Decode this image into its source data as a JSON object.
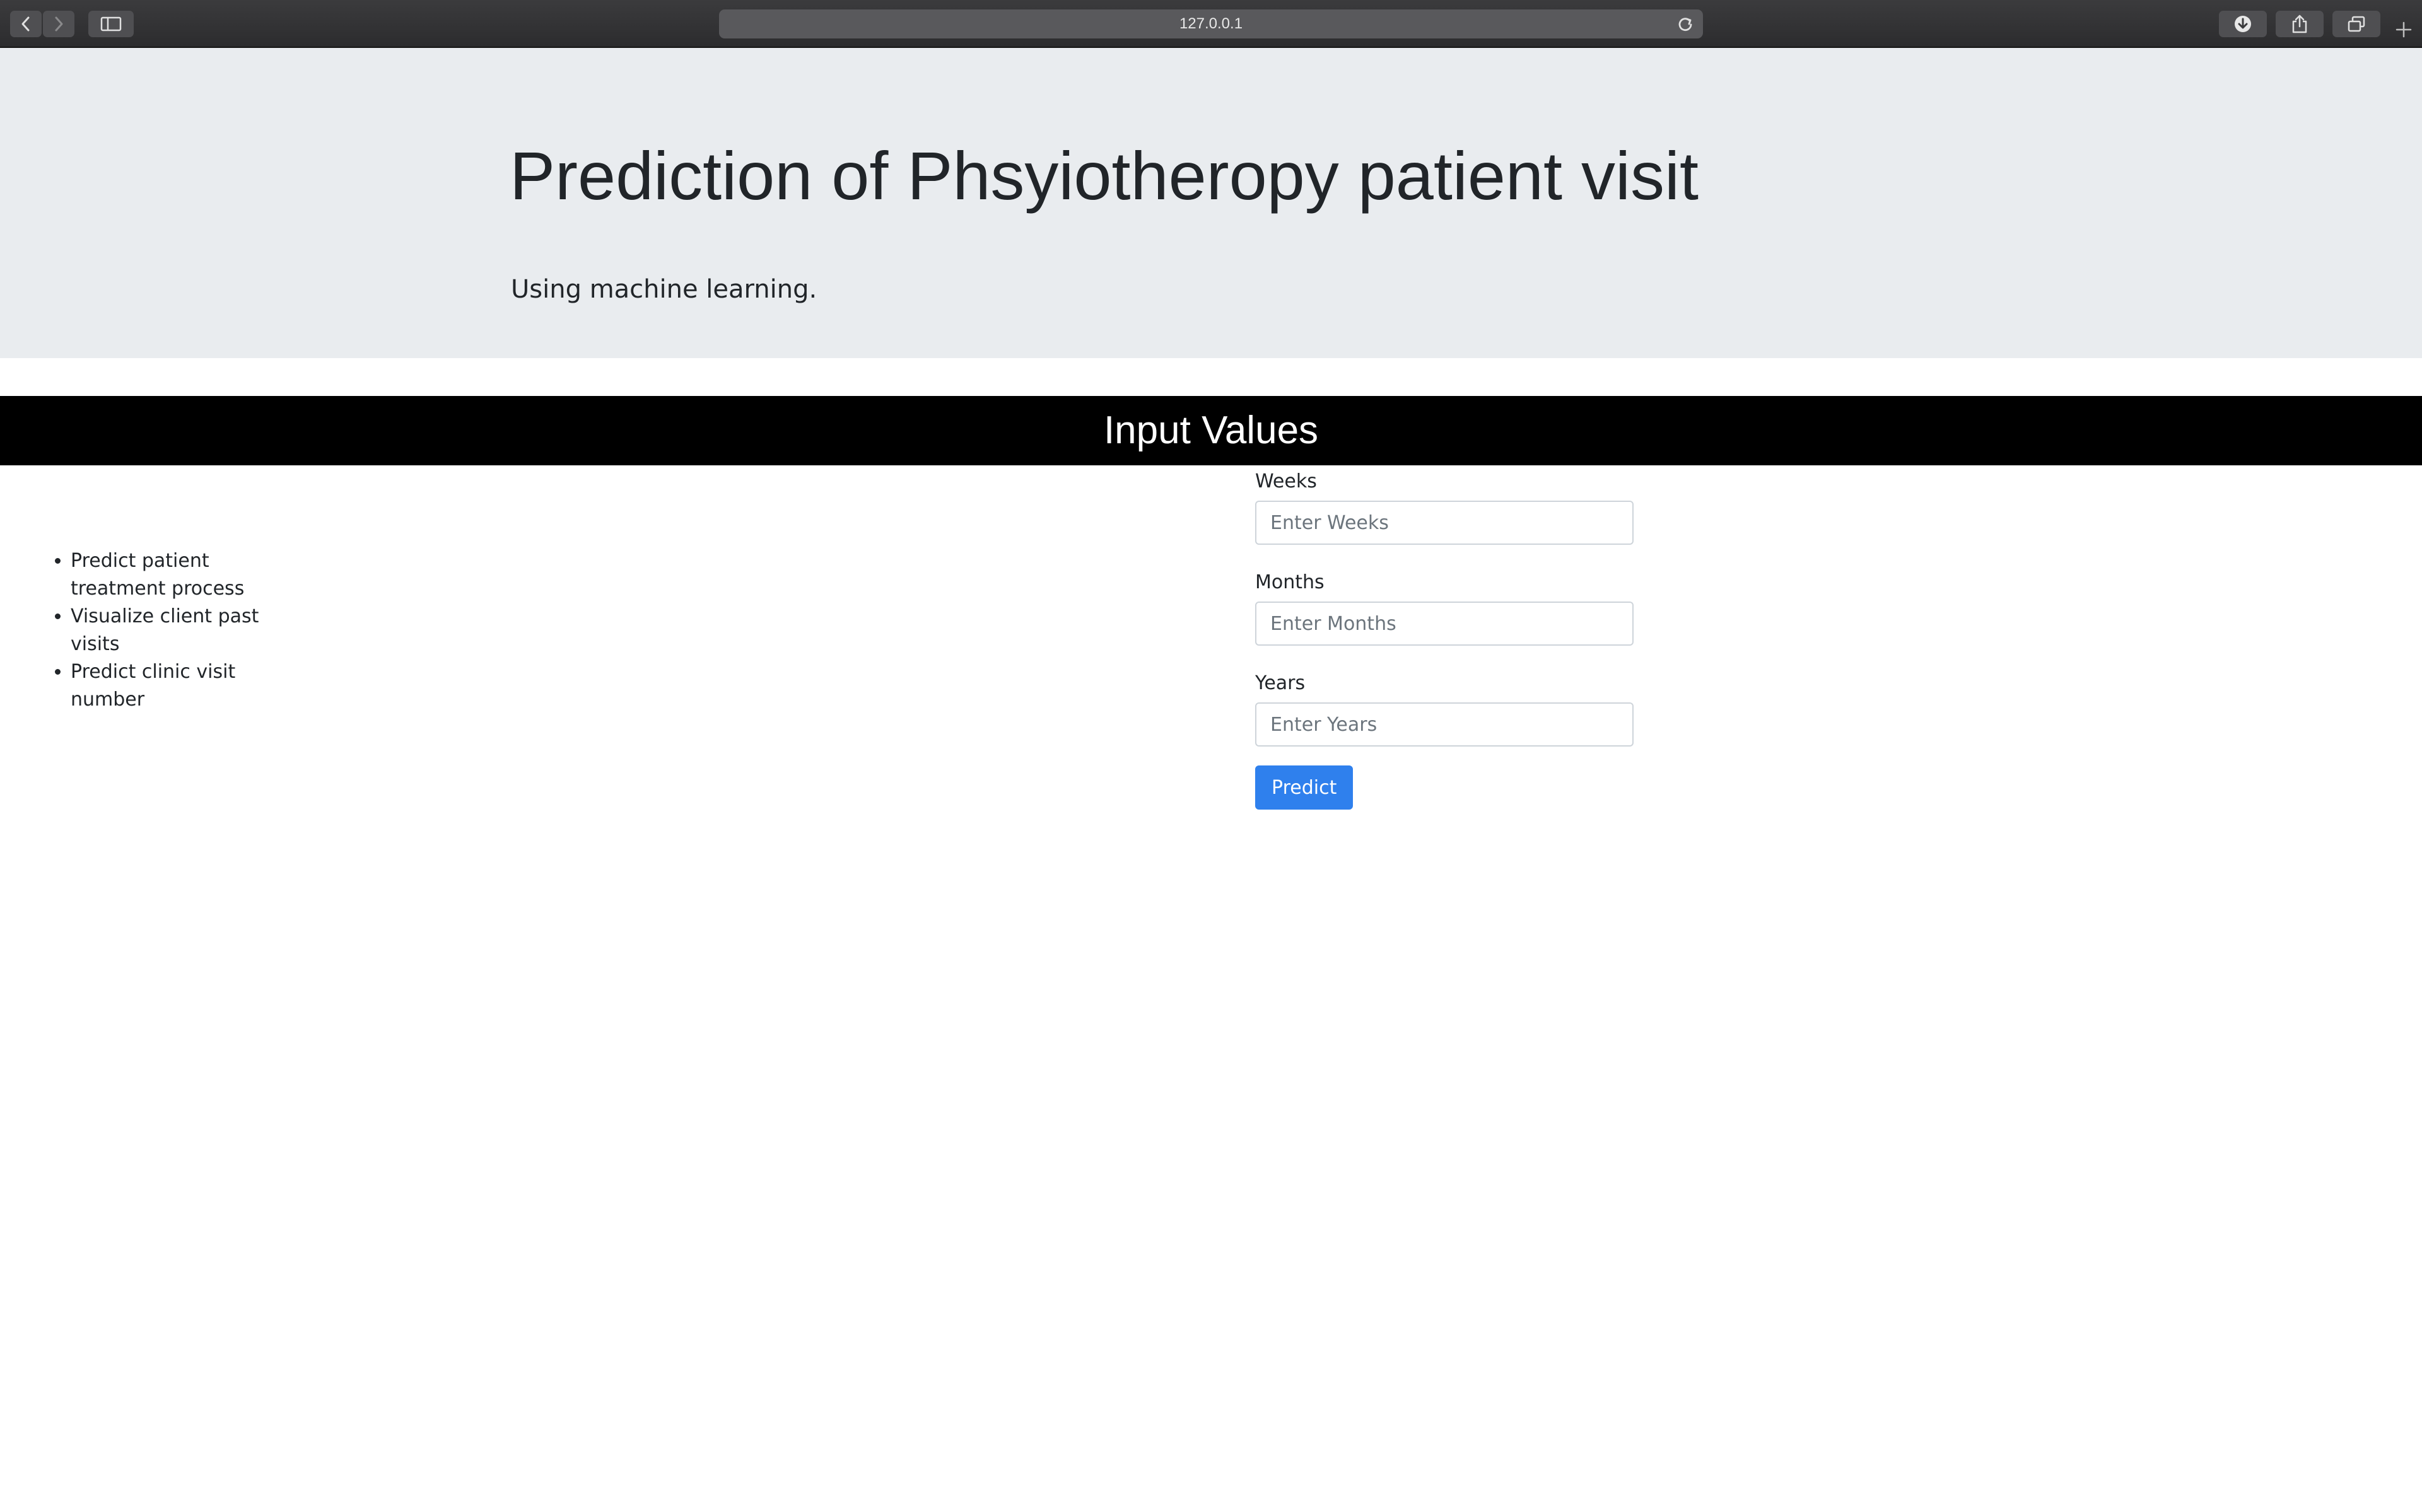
{
  "browser": {
    "url": "127.0.0.1",
    "icons": {
      "back": "chevron-left-icon",
      "forward": "chevron-right-icon",
      "sidebar": "sidebar-icon",
      "reload": "reload-icon",
      "downloads": "download-icon",
      "share": "share-icon",
      "tabs": "tabs-overview-icon",
      "new_tab": "plus-icon"
    }
  },
  "header": {
    "title": "Prediction of Phsyiotheropy patient visit",
    "subtitle": "Using machine learning."
  },
  "section": {
    "title": "Input Values"
  },
  "features": [
    "Predict patient treatment process",
    "Visualize client past visits",
    "Predict clinic visit number"
  ],
  "form": {
    "weeks": {
      "label": "Weeks",
      "placeholder": "Enter Weeks",
      "value": ""
    },
    "months": {
      "label": "Months",
      "placeholder": "Enter Months",
      "value": ""
    },
    "years": {
      "label": "Years",
      "placeholder": "Enter Years",
      "value": ""
    },
    "submit_label": "Predict"
  },
  "colors": {
    "jumbotron_bg": "#e9ecef",
    "section_bar_bg": "#000000",
    "button_primary": "#2f80ed"
  }
}
